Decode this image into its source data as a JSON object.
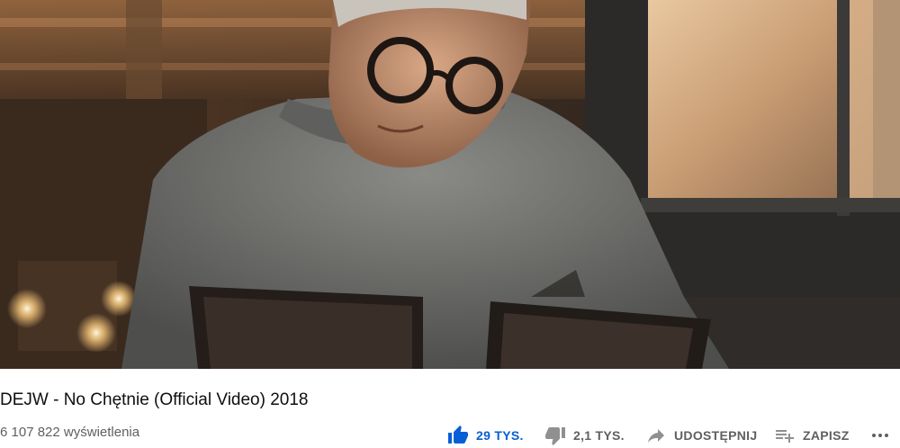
{
  "video": {
    "title": "DEJW - No Chętnie (Official Video) 2018",
    "views": "6 107 822 wyświetlenia"
  },
  "actions": {
    "like": {
      "label": "29 TYS.",
      "icon": "thumb-up-icon",
      "color": "#065fd4"
    },
    "dislike": {
      "label": "2,1 TYS.",
      "icon": "thumb-down-icon"
    },
    "share": {
      "label": "UDOSTĘPNIJ",
      "icon": "share-icon"
    },
    "save": {
      "label": "ZAPISZ",
      "icon": "playlist-add-icon"
    },
    "more": {
      "icon": "more-horiz-icon"
    }
  }
}
